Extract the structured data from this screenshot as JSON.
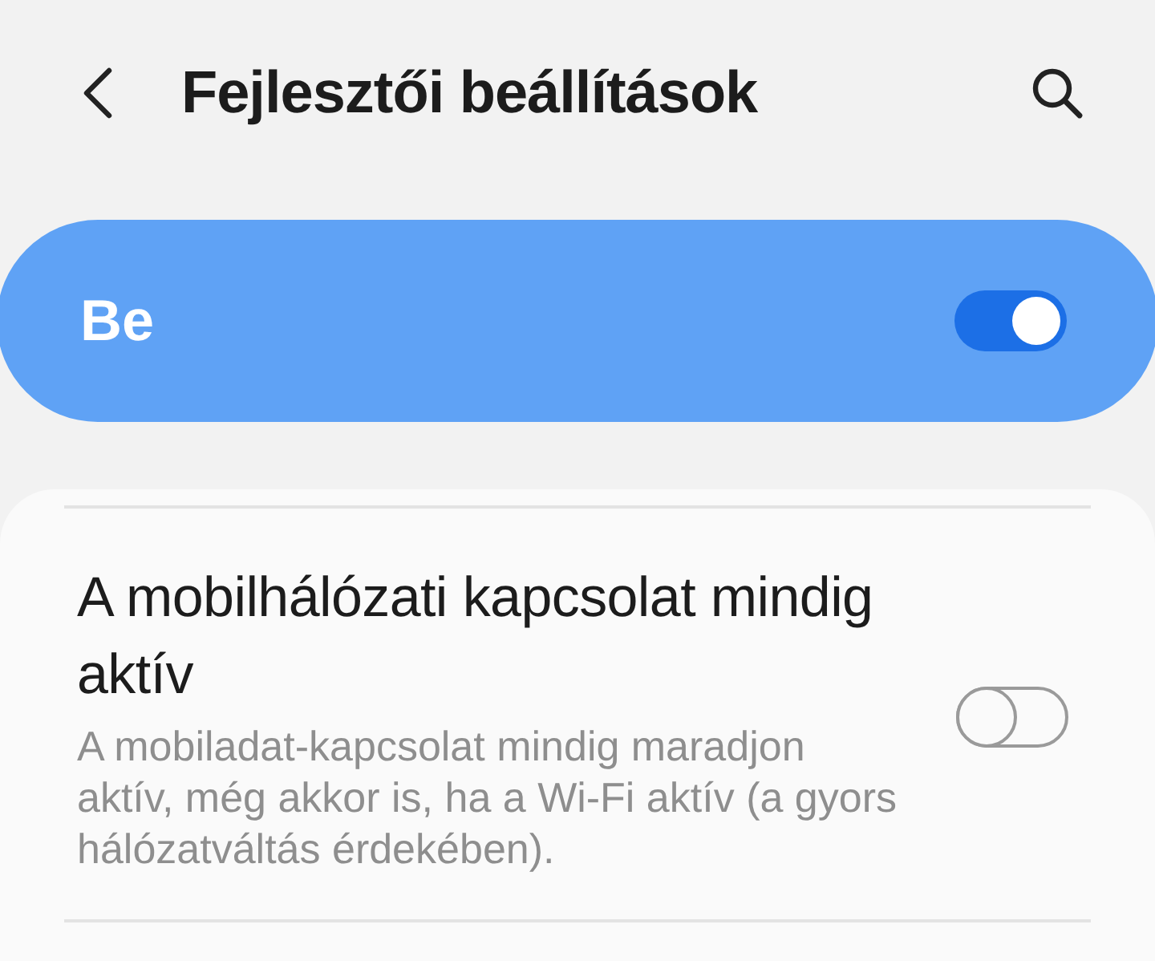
{
  "header": {
    "title": "Fejlesztői beállítások"
  },
  "master_switch": {
    "label": "Be",
    "on": true
  },
  "settings": [
    {
      "title": "A mobilhálózati kapcsolat mindig aktív",
      "description": "A mobiladat-kapcsolat mindig maradjon aktív, még akkor is, ha a Wi-Fi aktív (a gyors hálózatváltás érdekében).",
      "on": false
    }
  ]
}
